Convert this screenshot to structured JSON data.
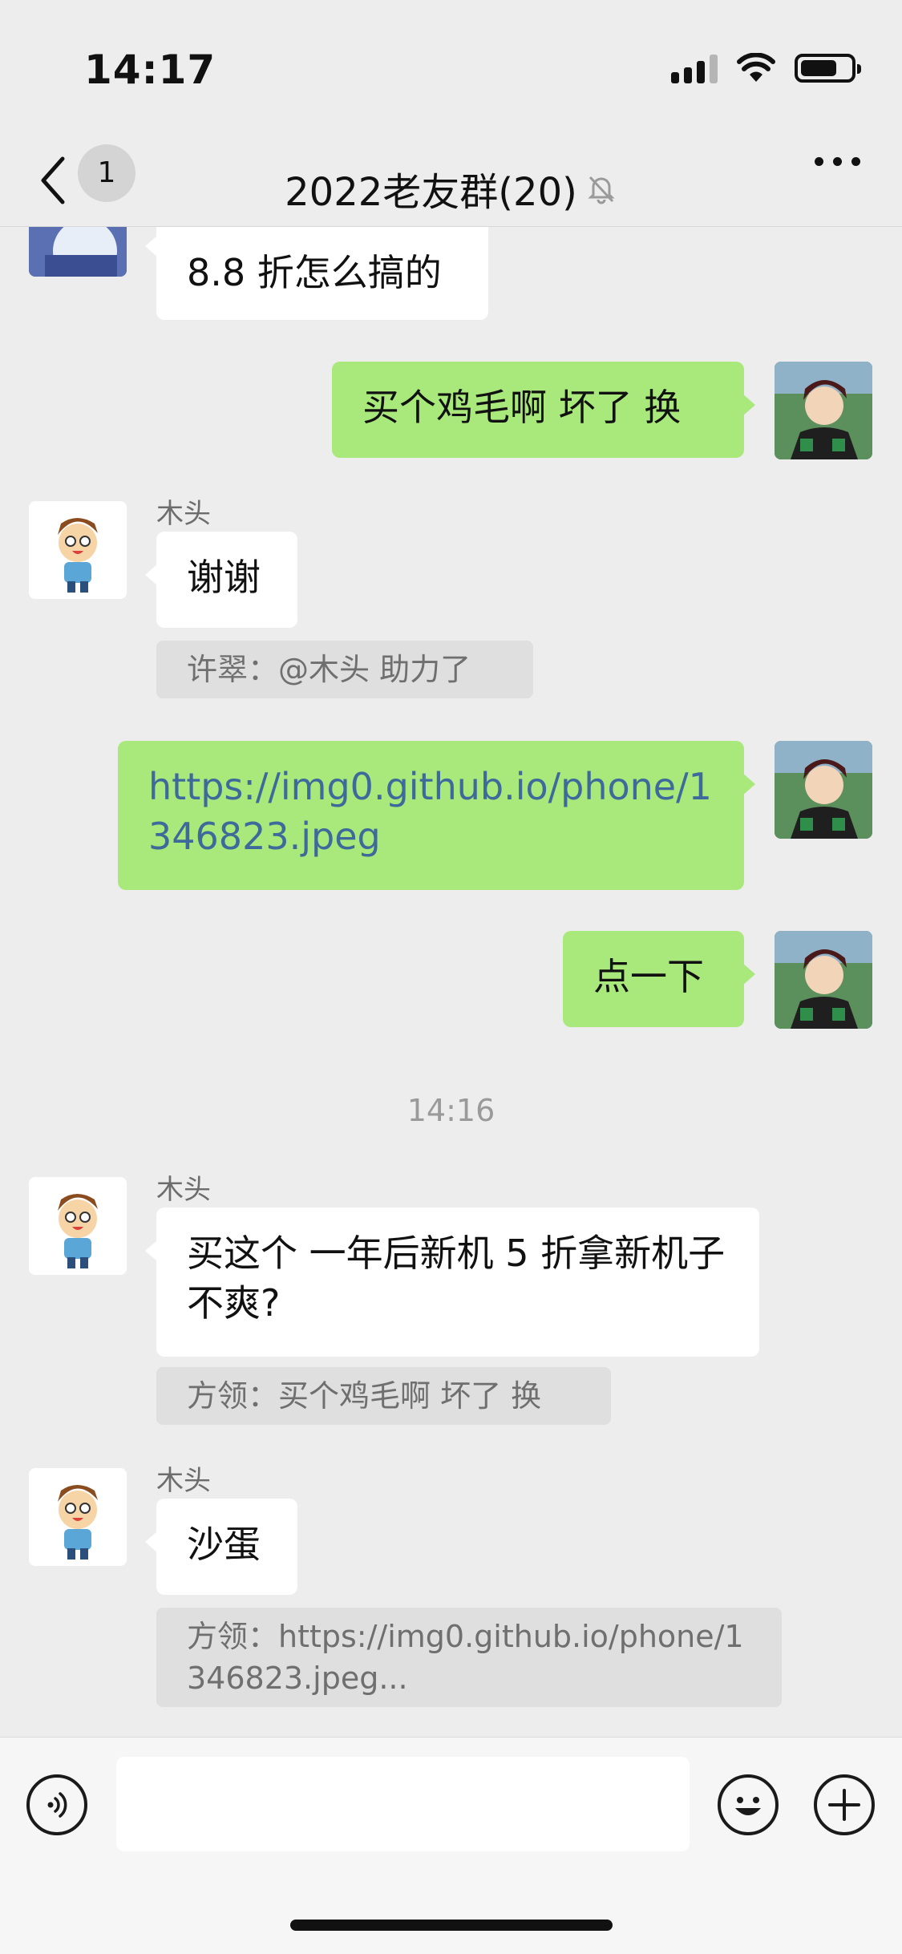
{
  "status": {
    "time": "14:17"
  },
  "nav": {
    "back_badge": "1",
    "title": "2022老友群(20)"
  },
  "messages": {
    "m1_text": "8.8 折怎么搞的",
    "m2_text": "买个鸡毛啊 坏了 换",
    "m3_sender": "木头",
    "m3_text": "谢谢",
    "m3_quote": "许翠：@木头 助力了",
    "m4_text": "https://img0.github.io/phone/1346823.jpeg",
    "m5_text": "点一下",
    "timestamp": "14:16",
    "m6_sender": "木头",
    "m6_text": "买这个 一年后新机 5 折拿新机子 不爽?",
    "m6_quote": "方领：买个鸡毛啊 坏了 换",
    "m7_sender": "木头",
    "m7_text": "沙蛋",
    "m7_quote": "方领：https://img0.github.io/phone/1346823.jpeg..."
  },
  "input": {
    "value": ""
  },
  "icons": {
    "back": "chevron-left-icon",
    "mute": "bell-muted-icon",
    "more": "more-dots-icon",
    "voice": "voice-icon",
    "emoji": "emoji-icon",
    "add": "plus-icon"
  },
  "colors": {
    "background": "#ededed",
    "outgoing_bubble": "#a9e87a",
    "incoming_bubble": "#ffffff",
    "link": "#3d6a9a"
  }
}
